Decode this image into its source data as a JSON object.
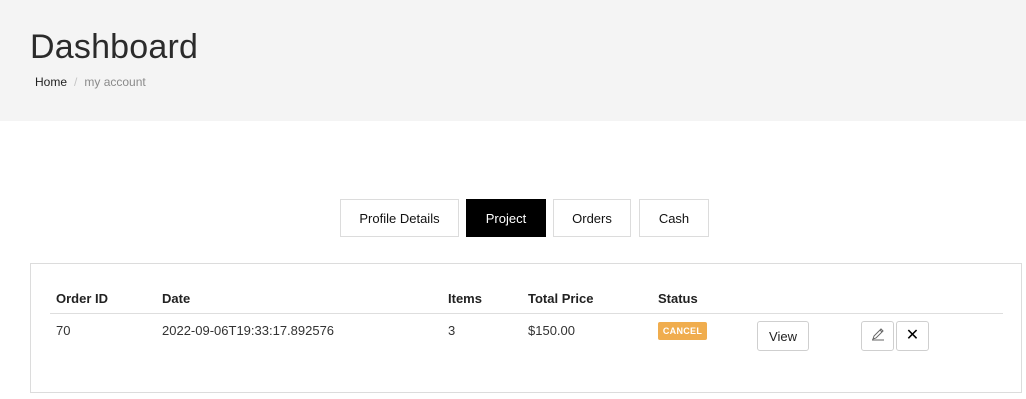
{
  "header": {
    "title": "Dashboard",
    "breadcrumb": {
      "home": "Home",
      "separator": "/",
      "current": "my account"
    }
  },
  "tabs": [
    {
      "label": "Profile Details",
      "active": false
    },
    {
      "label": "Project",
      "active": true
    },
    {
      "label": "Orders",
      "active": false
    },
    {
      "label": "Cash",
      "active": false
    }
  ],
  "orders_table": {
    "columns": [
      "Order ID",
      "Date",
      "Items",
      "Total Price",
      "Status"
    ],
    "rows": [
      {
        "order_id": "70",
        "date": "2022-09-06T19:33:17.892576",
        "items": "3",
        "total_price": "$150.00",
        "status": "CANCEL",
        "status_color": "#f0ad4e",
        "view_label": "View",
        "edit_icon": "pencil-icon",
        "delete_icon": "close-icon"
      }
    ]
  }
}
